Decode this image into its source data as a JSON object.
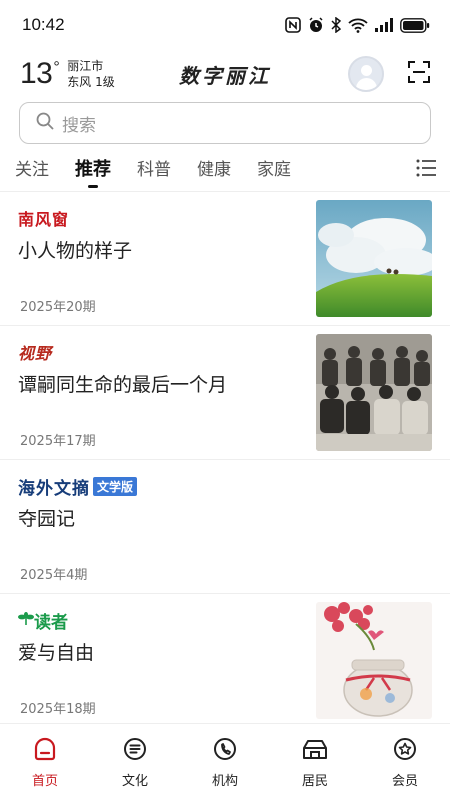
{
  "status_bar": {
    "time": "10:42",
    "icons": [
      "nfc-icon",
      "alarm-icon",
      "bluetooth-icon",
      "wifi-icon",
      "signal-icon",
      "battery-icon"
    ]
  },
  "header": {
    "temperature": "13",
    "degree_symbol": "°",
    "city": "丽江市",
    "wind": "东风 1级",
    "brand": "数字丽江"
  },
  "search": {
    "placeholder": "搜索"
  },
  "tabs": [
    {
      "label": "关注",
      "active": false
    },
    {
      "label": "推荐",
      "active": true
    },
    {
      "label": "科普",
      "active": false
    },
    {
      "label": "健康",
      "active": false
    },
    {
      "label": "家庭",
      "active": false
    }
  ],
  "articles": [
    {
      "source": "南风窗",
      "title": "小人物的样子",
      "date": "2025年20期"
    },
    {
      "source": "视野",
      "title": "谭嗣同生命的最后一个月",
      "date": "2025年17期"
    },
    {
      "source": "海外文摘",
      "source_badge": "文学版",
      "title": "夺园记",
      "date": "2025年4期"
    },
    {
      "source": "读者",
      "title": "爱与自由",
      "date": "2025年18期"
    }
  ],
  "bottom_nav": [
    {
      "label": "首页",
      "active": true
    },
    {
      "label": "文化",
      "active": false
    },
    {
      "label": "机构",
      "active": false
    },
    {
      "label": "居民",
      "active": false
    },
    {
      "label": "会员",
      "active": false
    }
  ],
  "colors": {
    "accent": "#c8191f",
    "text": "#222222",
    "muted": "#777777"
  }
}
